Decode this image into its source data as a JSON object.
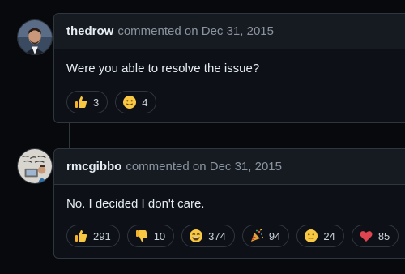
{
  "comments": [
    {
      "author": "thedrow",
      "action": "commented on",
      "date": "Dec 31, 2015",
      "body": "Were you able to resolve the issue?",
      "reactions": [
        {
          "emoji": "thumbs-up-icon",
          "count": "3"
        },
        {
          "emoji": "smile-icon",
          "count": "4"
        }
      ]
    },
    {
      "author": "rmcgibbo",
      "action": "commented on",
      "date": "Dec 31, 2015",
      "body": "No. I decided I don't care.",
      "reactions": [
        {
          "emoji": "thumbs-up-icon",
          "count": "291"
        },
        {
          "emoji": "thumbs-down-icon",
          "count": "10"
        },
        {
          "emoji": "laugh-icon",
          "count": "374"
        },
        {
          "emoji": "hooray-icon",
          "count": "94"
        },
        {
          "emoji": "confused-icon",
          "count": "24"
        },
        {
          "emoji": "heart-icon",
          "count": "85"
        }
      ]
    }
  ],
  "colors": {
    "background": "#07090d",
    "border": "#30363d",
    "header": "#161b22",
    "text": "#e6edf3",
    "muted": "#8b949e"
  }
}
